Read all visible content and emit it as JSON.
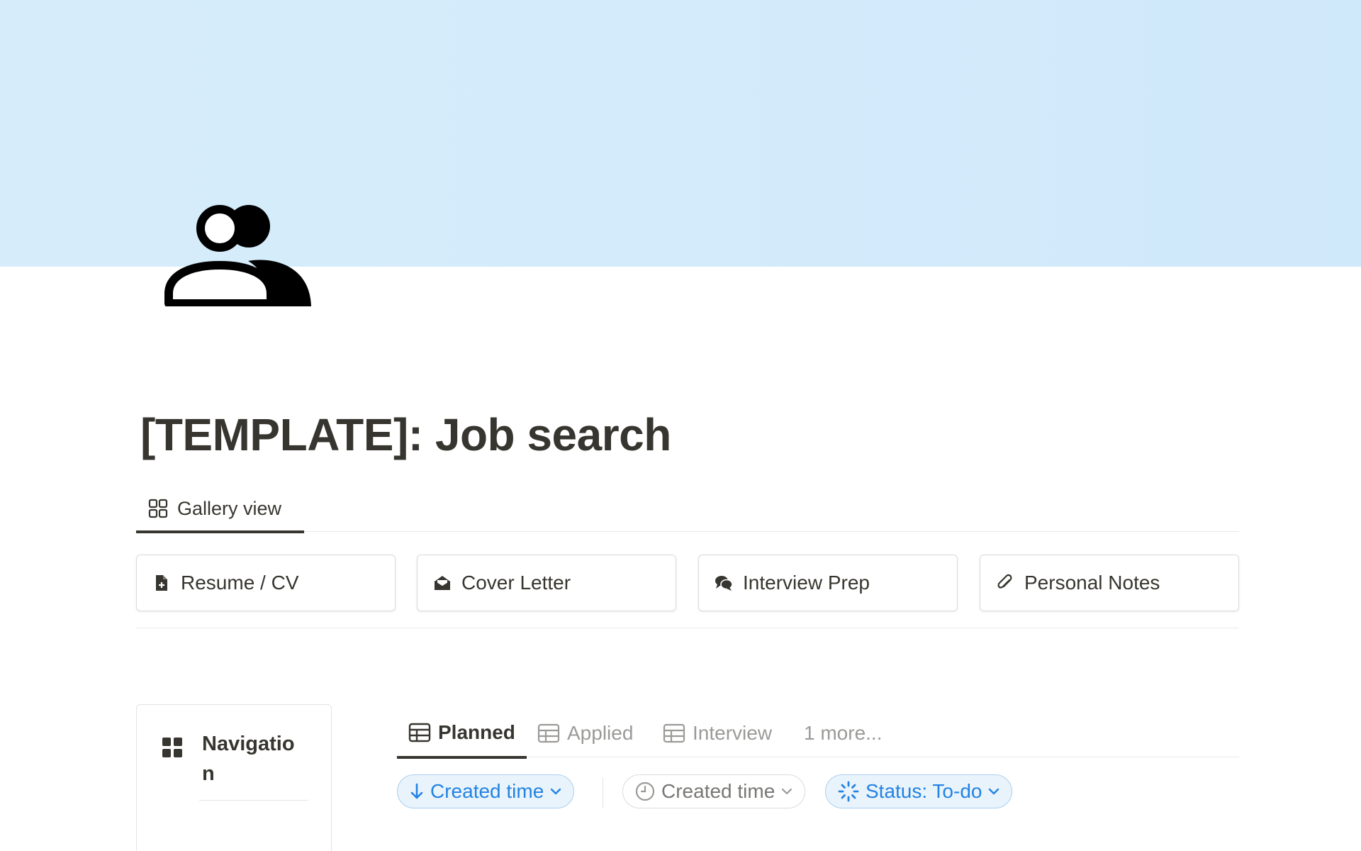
{
  "page": {
    "title": "[TEMPLATE]: Job search",
    "icon": "people-icon",
    "cover_color": "#d6ecfb"
  },
  "view_tabs": [
    {
      "label": "Gallery view",
      "icon": "gallery-icon",
      "active": true
    }
  ],
  "gallery_cards": [
    {
      "label": "Resume / CV",
      "icon": "document-plus-icon"
    },
    {
      "label": "Cover Letter",
      "icon": "envelope-open-icon"
    },
    {
      "label": "Interview Prep",
      "icon": "chat-bubbles-icon"
    },
    {
      "label": "Personal Notes",
      "icon": "paperclip-icon"
    }
  ],
  "navigation": {
    "label": "Navigation",
    "icon": "grid-icon"
  },
  "database_tabs": [
    {
      "label": "Planned",
      "icon": "table-icon",
      "active": true
    },
    {
      "label": "Applied",
      "icon": "table-icon",
      "active": false
    },
    {
      "label": "Interview",
      "icon": "table-icon",
      "active": false
    },
    {
      "label": "1 more...",
      "icon": "",
      "active": false
    }
  ],
  "filters": {
    "sort": {
      "label": "Created time",
      "icon": "arrow-down-icon"
    },
    "created": {
      "label": "Created time",
      "icon": "clock-icon"
    },
    "status": {
      "label": "Status: To-do",
      "icon": "status-loading-icon"
    }
  },
  "colors": {
    "text": "#37352f",
    "muted": "#9b9a97",
    "accent_blue": "#2383e2"
  }
}
